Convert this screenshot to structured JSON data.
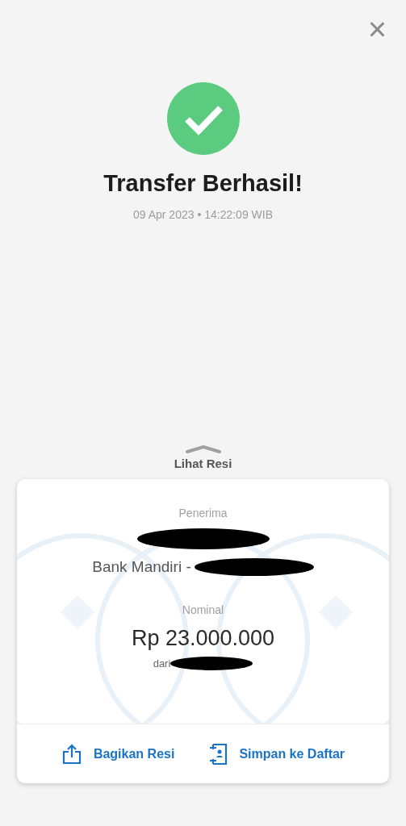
{
  "header": {
    "close": "×"
  },
  "status": {
    "title": "Transfer Berhasil!",
    "timestamp": "09 Apr 2023 • 14:22:09 WIB"
  },
  "receipt_toggle": {
    "label": "Lihat Resi"
  },
  "receipt": {
    "recipient_label": "Penerima",
    "bank": "Bank Mandiri -",
    "amount_label": "Nominal",
    "amount": "Rp 23.000.000",
    "from_label": "dari"
  },
  "actions": [
    {
      "kind": "share",
      "label": "Bagikan Resi"
    },
    {
      "kind": "save",
      "label": "Simpan ke Daftar"
    }
  ]
}
